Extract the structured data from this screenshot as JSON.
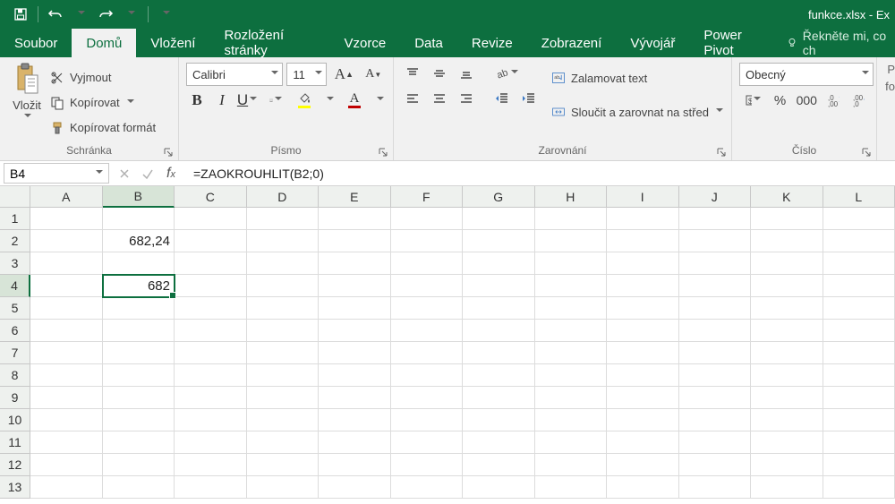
{
  "title": "funkce.xlsx - Ex",
  "qat": {
    "save": "save-icon",
    "undo": "undo-icon",
    "redo": "redo-icon"
  },
  "tabs": {
    "file": "Soubor",
    "items": [
      "Domů",
      "Vložení",
      "Rozložení stránky",
      "Vzorce",
      "Data",
      "Revize",
      "Zobrazení",
      "Vývojář",
      "Power Pivot"
    ],
    "active_index": 0,
    "tell_me": "Řekněte mi, co ch"
  },
  "ribbon": {
    "clipboard": {
      "paste": "Vložit",
      "cut": "Vyjmout",
      "copy": "Kopírovat",
      "format_painter": "Kopírovat formát",
      "label": "Schránka"
    },
    "font": {
      "name": "Calibri",
      "size": "11",
      "increase": "A",
      "decrease": "A",
      "bold": "B",
      "italic": "I",
      "underline": "U",
      "label": "Písmo",
      "fill_color": "#ffff00",
      "font_color": "#c00000"
    },
    "alignment": {
      "wrap": "Zalamovat text",
      "merge": "Sloučit a zarovnat na střed",
      "label": "Zarovnání"
    },
    "number": {
      "format": "Obecný",
      "label": "Číslo"
    },
    "cells_cut": {
      "label_p": "P",
      "label_fo": "fo"
    }
  },
  "namebox": "B4",
  "formula": "=ZAOKROUHLIT(B2;0)",
  "columns": [
    "A",
    "B",
    "C",
    "D",
    "E",
    "F",
    "G",
    "H",
    "I",
    "J",
    "K",
    "L"
  ],
  "rows": [
    "1",
    "2",
    "3",
    "4",
    "5",
    "6",
    "7",
    "8",
    "9",
    "10",
    "11",
    "12",
    "13"
  ],
  "selected_col_index": 1,
  "selected_row_index": 3,
  "cell_values": {
    "B2": "682,24",
    "B4": "682"
  }
}
